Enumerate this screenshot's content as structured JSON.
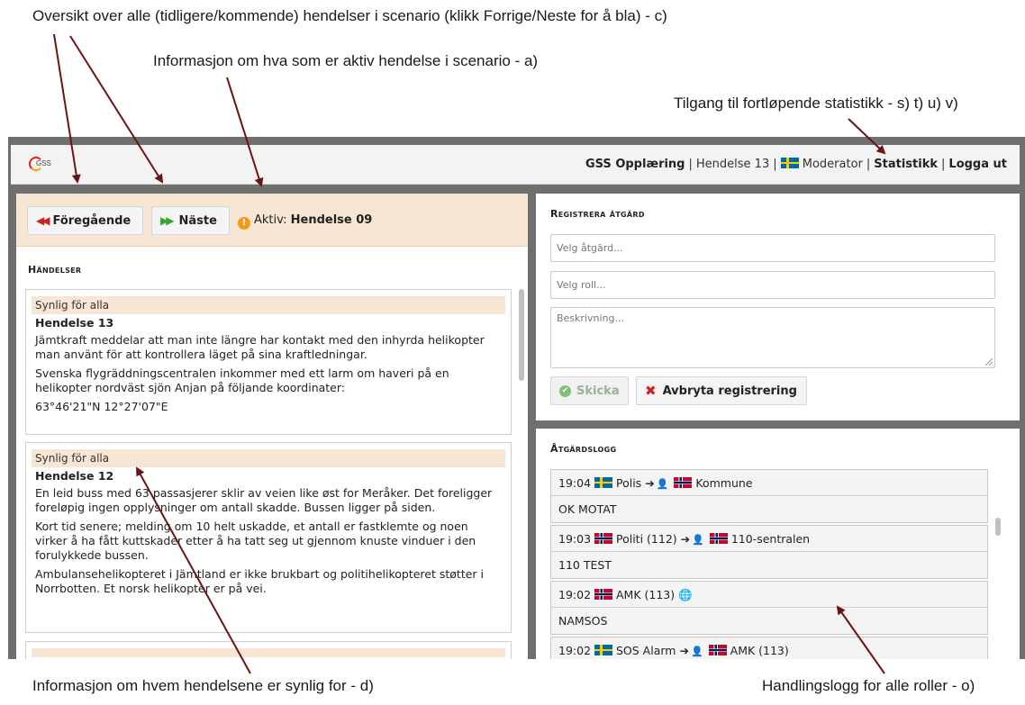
{
  "annotations": {
    "overview": "Oversikt over alle (tidligere/kommende) hendelser i scenario (klikk Forrige/Neste for å bla) - c)",
    "active": "Informasjon om hva som er aktiv hendelse i scenario - a)",
    "stats": "Tilgang til fortløpende statistikk - s) t) u) v)",
    "visible": "Informasjon om hvem hendelsene er synlig for - d)",
    "log": "Handlingslogg for alle roller - o)"
  },
  "topbar": {
    "logo_text": "GSS",
    "app_name": "GSS Opplæring",
    "event": "Hendelse 13",
    "role": "Moderator",
    "stats": "Statistikk",
    "logout": "Logga ut"
  },
  "toolbar": {
    "prev": "Föregående",
    "next": "Näste",
    "active_label": "Aktiv:",
    "active_value": "Hendelse 09"
  },
  "events": {
    "title": "Händelser",
    "items": [
      {
        "visibility": "Synlig för alla",
        "title": "Hendelse 13",
        "paragraphs": [
          "Jämtkraft meddelar att man inte längre har kontakt med den inhyrda helikopter man använt för att kontrollera läget på sina kraftledningar.",
          "Svenska flygräddningscentralen inkommer med ett larm om haveri på en helikopter nordväst sjön Anjan på följande koordinater:",
          "63°46'21\"N 12°27'07\"E"
        ]
      },
      {
        "visibility": "Synlig för alla",
        "title": "Hendelse 12",
        "paragraphs": [
          "En leid buss med 63 passasjerer sklir av veien like øst for Meråker. Det foreligger foreløpig ingen opplysninger om antall skadde. Bussen ligger på siden.",
          "Kort tid senere; melding om 10 helt uskadde, et antall er fastklemte og noen virker å ha fått kuttskader etter å ha tatt seg ut gjennom knuste vinduer i den forulykkede bussen.",
          "Ambulansehelikopteret i Jämtland er ikke brukbart og politihelikopteret støtter i Norrbotten. Et norsk helikopter er på vei."
        ]
      }
    ]
  },
  "register": {
    "title": "Registrera åtgärd",
    "action_placeholder": "Velg åtgärd...",
    "role_placeholder": "Velg roll...",
    "desc_placeholder": "Beskrivning...",
    "send": "Skicka",
    "cancel": "Avbryta registrering"
  },
  "log": {
    "title": "Åtgärdslogg",
    "items": [
      {
        "time": "19:04",
        "from_flag": "se",
        "from": "Polis",
        "to_flag": "no",
        "to": "Kommune",
        "message": "OK MOTAT"
      },
      {
        "time": "19:03",
        "from_flag": "no",
        "from": "Politi (112)",
        "to_flag": "no",
        "to": "110-sentralen",
        "message": "110 TEST"
      },
      {
        "time": "19:02",
        "from_flag": "no",
        "from": "AMK (113)",
        "to_flag": "",
        "to": "",
        "message": "NAMSOS"
      },
      {
        "time": "19:02",
        "from_flag": "se",
        "from": "SOS Alarm",
        "to_flag": "no",
        "to": "AMK (113)",
        "message": ""
      }
    ]
  },
  "colors": {
    "highlight": "#f8e6d4",
    "annotation_arrow": "#6b1414",
    "frame": "#6f6f6f"
  }
}
